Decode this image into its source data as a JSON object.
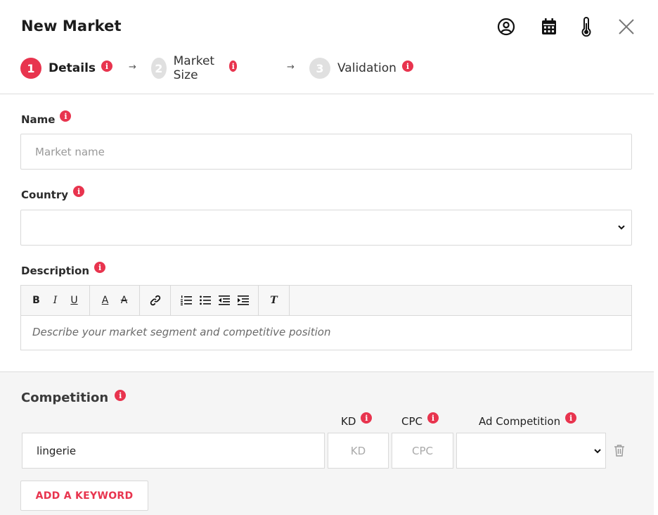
{
  "dialog": {
    "title": "New Market"
  },
  "header_icons": [
    "user-circle-icon",
    "calendar-icon",
    "thermometer-icon",
    "close-icon"
  ],
  "steps": [
    {
      "number": "1",
      "label": "Details",
      "active": true
    },
    {
      "number": "2",
      "label": "Market Size",
      "active": false
    },
    {
      "number": "3",
      "label": "Validation",
      "active": false
    }
  ],
  "step_arrow": "→",
  "info_glyph": "i",
  "name_field": {
    "label": "Name",
    "placeholder": "Market name"
  },
  "country_field": {
    "label": "Country",
    "value": ""
  },
  "description_field": {
    "label": "Description",
    "placeholder": "Describe your market segment and competitive position",
    "toolbar": {
      "bold": "B",
      "italic": "I",
      "underline": "U",
      "font_color": "A",
      "background_color": "A",
      "link": "link-icon",
      "ordered_list": "ordered-list-icon",
      "bullet_list": "bullet-list-icon",
      "outdent": "outdent-icon",
      "indent": "indent-icon",
      "clear_format": "T"
    }
  },
  "competition": {
    "title": "Competition",
    "columns": {
      "kd": "KD",
      "cpc": "CPC",
      "ad_competition": "Ad Competition"
    },
    "rows": [
      {
        "keyword": "lingerie",
        "kd_placeholder": "KD",
        "cpc_placeholder": "CPC",
        "ad_competition": ""
      }
    ],
    "add_button": "ADD A KEYWORD"
  },
  "colors": {
    "accent": "#e8344e",
    "inactive_step": "#e0e0e0",
    "section_bg": "#f5f5f5"
  }
}
